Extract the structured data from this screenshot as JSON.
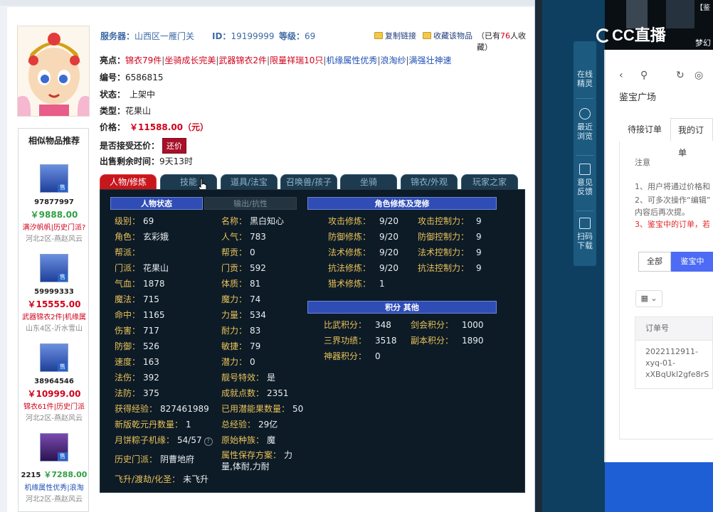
{
  "header": {
    "server_label": "服务器：",
    "server_value": "山西区一雁门关",
    "id_label": "ID：",
    "id_value": "19199999",
    "level_label": "等级：",
    "level_value": "69",
    "copy_link": "复制链接",
    "collect": "收藏该物品",
    "fav_prefix": "（已有",
    "fav_count": "76",
    "fav_suffix": "人收藏）"
  },
  "highlights": {
    "label": "亮点：",
    "items": [
      {
        "text": "锦衣79件"
      },
      {
        "text": "坐骑成长完美"
      },
      {
        "text": "武器锦衣2件"
      },
      {
        "text": "限量祥瑞10只"
      },
      {
        "text": "机缘属性优秀"
      },
      {
        "text": "浪淘纱"
      },
      {
        "text": "满强壮神速"
      }
    ]
  },
  "info": {
    "code_label": "编号：",
    "code_value": "6586815",
    "status_label": "状态：",
    "status_value": "上架中",
    "type_label": "类型：",
    "type_value": "花果山",
    "price_label": "价格：",
    "price_value": "￥11588.00（元）",
    "counter_label": "是否接受还价：",
    "counter_btn": "还价",
    "remain_label": "出售剩余时间：",
    "remain_value": "9天13时"
  },
  "tabs": [
    "人物/修炼",
    "技能",
    "道具/法宝",
    "召唤兽/孩子",
    "坐骑",
    "锦衣/外观",
    "玩家之家"
  ],
  "panel": {
    "hdr_status": "人物状态",
    "hdr_output": "输出/抗性",
    "hdr_cultivation": "角色修炼及宠修",
    "hdr_score": "积分 其他",
    "left": [
      {
        "l": "级别：",
        "v": "69"
      },
      {
        "l": "角色：",
        "v": "玄彩娥"
      },
      {
        "l": "帮派：",
        "v": ""
      },
      {
        "l": "门派：",
        "v": "花果山"
      },
      {
        "l": "气血：",
        "v": "1878"
      },
      {
        "l": "魔法：",
        "v": "715"
      },
      {
        "l": "命中：",
        "v": "1165"
      },
      {
        "l": "伤害：",
        "v": "717"
      },
      {
        "l": "防御：",
        "v": "526"
      },
      {
        "l": "速度：",
        "v": "163"
      },
      {
        "l": "法伤：",
        "v": "392"
      },
      {
        "l": "法防：",
        "v": "375"
      },
      {
        "l": "获得经验：",
        "v": "827461989"
      },
      {
        "l": "新版乾元丹数量：",
        "v": "1"
      },
      {
        "l": "月饼粽子机缘：",
        "v": "54/57"
      },
      {
        "l": "历史门派：",
        "v": "阴曹地府"
      },
      {
        "l": "飞升/渡劫/化圣：",
        "v": "未飞升"
      }
    ],
    "mid": [
      {
        "l": "名称：",
        "v": "黑白知心"
      },
      {
        "l": "人气：",
        "v": "783"
      },
      {
        "l": "帮贡：",
        "v": "0"
      },
      {
        "l": "门贡：",
        "v": "592"
      },
      {
        "l": "体质：",
        "v": "81"
      },
      {
        "l": "魔力：",
        "v": "74"
      },
      {
        "l": "力量：",
        "v": "534"
      },
      {
        "l": "耐力：",
        "v": "83"
      },
      {
        "l": "敏捷：",
        "v": "79"
      },
      {
        "l": "潜力：",
        "v": "0"
      },
      {
        "l": "靓号特效：",
        "v": "是"
      },
      {
        "l": "成就点数：",
        "v": "2351"
      },
      {
        "l": "已用潜能果数量：",
        "v": "50"
      },
      {
        "l": "总经验：",
        "v": "29亿"
      },
      {
        "l": "原始种族：",
        "v": "魔"
      },
      {
        "l": "属性保存方案：",
        "v": "力"
      },
      {
        "l": "",
        "v": "量,体耐,力耐"
      }
    ],
    "cult": [
      {
        "l": "攻击修炼：",
        "v": "9/20",
        "l2": "攻击控制力：",
        "v2": "9"
      },
      {
        "l": "防御修炼：",
        "v": "9/20",
        "l2": "防御控制力：",
        "v2": "9"
      },
      {
        "l": "法术修炼：",
        "v": "9/20",
        "l2": "法术控制力：",
        "v2": "9"
      },
      {
        "l": "抗法修炼：",
        "v": "9/20",
        "l2": "抗法控制力：",
        "v2": "9"
      },
      {
        "l": "猎术修炼：",
        "v": "1",
        "l2": "",
        "v2": ""
      }
    ],
    "score": [
      {
        "l": "比武积分：",
        "v": "348",
        "l2": "剑会积分：",
        "v2": "1000"
      },
      {
        "l": "三界功绩：",
        "v": "3518",
        "l2": "副本积分：",
        "v2": "1890"
      },
      {
        "l": "神器积分：",
        "v": "0",
        "l2": "",
        "v2": ""
      }
    ]
  },
  "similar": {
    "title": "相似物品推荐",
    "shou": "售",
    "items": [
      {
        "id": "97877997",
        "price": "￥9888.00",
        "price_color": "#2ea043",
        "tags": "满汐帆帆|历史门派?",
        "server": "河北2区-燕赵风云"
      },
      {
        "id": "59999333",
        "price": "￥15555.00",
        "price_color": "#d0021b",
        "tags": "武器锦衣2件|机缘属",
        "server": "山东4区-沂水雪山"
      },
      {
        "id": "38964546",
        "price": "￥10999.00",
        "price_color": "#d0021b",
        "tags": "锦衣61件|历史门派",
        "server": "河北2区-燕赵风云"
      },
      {
        "id": "2215",
        "price": "￥7288.00",
        "price_color": "#2ea043",
        "tags": "机缘属性优秀|浪淘",
        "server": "河北2区-燕赵风云"
      }
    ]
  },
  "cc": {
    "logo": "CC直播",
    "top_user": "梦幻",
    "top_channel": "【鉴",
    "side": [
      "在线精灵",
      "最近浏览",
      "意见反馈",
      "扫码下载"
    ],
    "title": "鉴宝广场",
    "tab_pending": "待接订单",
    "tab_mine": "我的订单",
    "notice_title": "注意",
    "note1": "1、用户将通过价格和",
    "note2": "2、可多次操作“编辑”",
    "note3": "内容后再次提。",
    "note4": "3、鉴宝中的订单，若",
    "filter_all": "全部",
    "filter_active": "鉴宝中",
    "col_label": "▦ ⌄",
    "th_order": "订单号",
    "order_line1": "2022112911-",
    "order_line2": "xyq-01-",
    "order_line3": "xXBqUkl2gfe8rS"
  }
}
